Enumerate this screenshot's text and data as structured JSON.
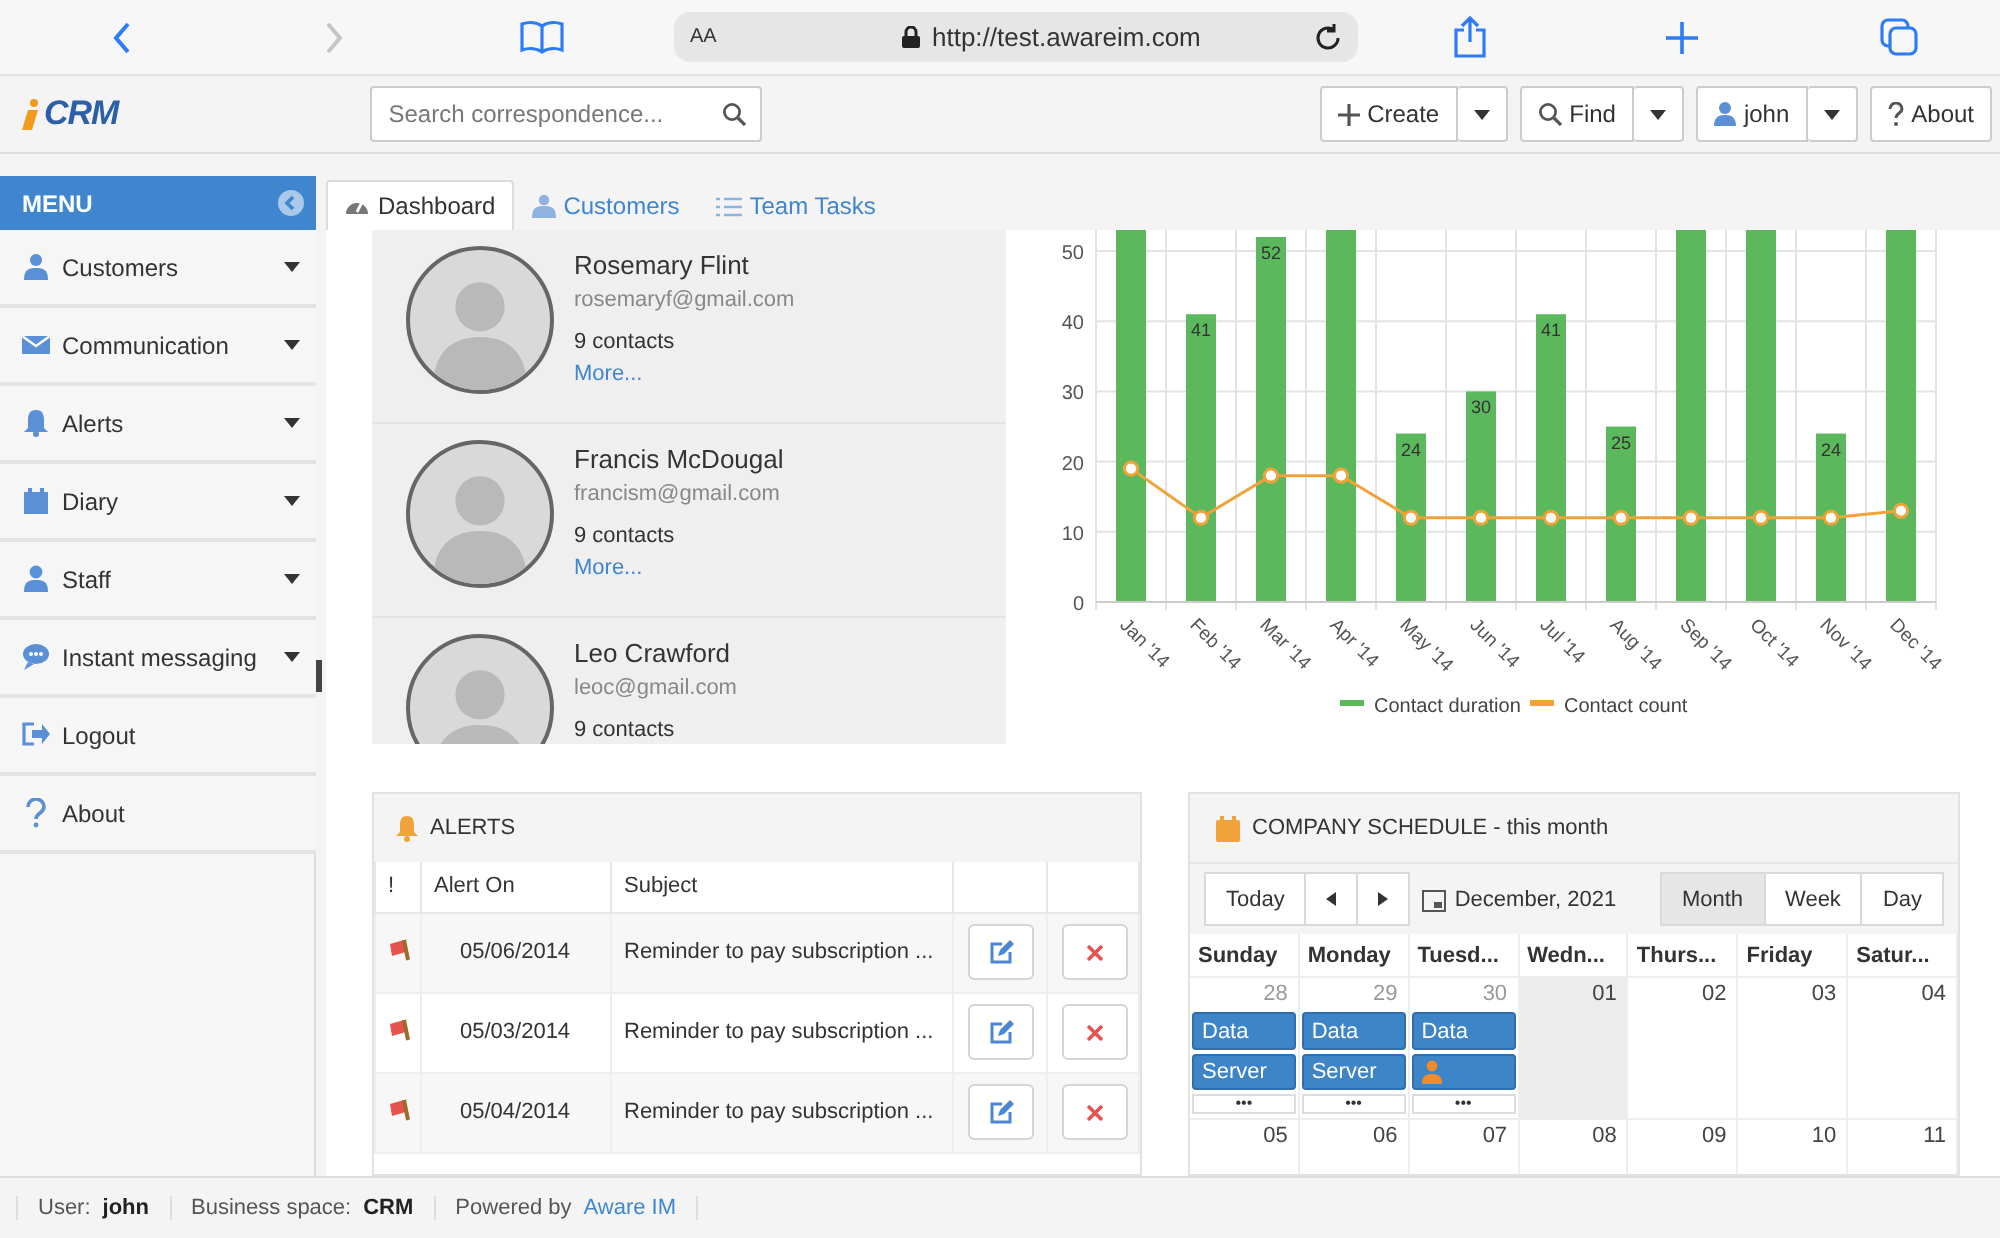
{
  "browser": {
    "text_size": "AA",
    "url": "http://test.awareim.com"
  },
  "header": {
    "logo": "CRM",
    "search": {
      "placeholder": "Search correspondence..."
    },
    "buttons": [
      {
        "label": "Create",
        "kind": "split"
      },
      {
        "label": "Find",
        "kind": "split"
      },
      {
        "label": "john",
        "kind": "split"
      },
      {
        "label": "About",
        "kind": "plain"
      }
    ]
  },
  "menu": {
    "title": "MENU",
    "items": [
      {
        "label": "Customers",
        "expandable": true
      },
      {
        "label": "Communication",
        "expandable": true
      },
      {
        "label": "Alerts",
        "expandable": true
      },
      {
        "label": "Diary",
        "expandable": true
      },
      {
        "label": "Staff",
        "expandable": true
      },
      {
        "label": "Instant messaging",
        "expandable": true
      },
      {
        "label": "Logout",
        "expandable": false
      },
      {
        "label": "About",
        "expandable": false
      }
    ]
  },
  "tabs": [
    {
      "label": "Dashboard",
      "selected": true
    },
    {
      "label": "Customers",
      "selected": false
    },
    {
      "label": "Team Tasks",
      "selected": false
    }
  ],
  "contacts": [
    {
      "name": "Rosemary Flint",
      "email": "rosemaryf@gmail.com",
      "count": "9 contacts",
      "link": "More..."
    },
    {
      "name": "Francis McDougal",
      "email": "francism@gmail.com",
      "count": "9 contacts",
      "link": "More..."
    },
    {
      "name": "Leo Crawford",
      "email": "leoc@gmail.com",
      "count": "9 contacts"
    }
  ],
  "chart": {
    "chart_data": {
      "type": "bar",
      "categories": [
        "Jan '14",
        "Feb '14",
        "Mar '14",
        "Apr '14",
        "May '14",
        "Jun '14",
        "Jul '14",
        "Aug '14",
        "Sep '14",
        "Oct '14",
        "Nov '14",
        "Dec '14"
      ],
      "series": [
        {
          "name": "Contact duration",
          "type": "bar",
          "color": "#5cb85c",
          "values": [
            53,
            41,
            52,
            53,
            24,
            30,
            41,
            25,
            53,
            53,
            24,
            53
          ]
        },
        {
          "name": "Contact count",
          "type": "line",
          "marker": "circle",
          "color": "#f0a33a",
          "values": [
            19,
            12,
            18,
            18,
            12,
            12,
            12,
            12,
            12,
            12,
            12,
            13
          ]
        }
      ],
      "ylim": [
        0,
        53
      ],
      "yticks": [
        0,
        10,
        20,
        30,
        40,
        50
      ],
      "grid": true,
      "legend": "bottom",
      "value_labels": [
        null,
        "41",
        "52",
        null,
        "24",
        "30",
        "41",
        "25",
        null,
        null,
        "24",
        null
      ]
    }
  },
  "alerts": {
    "title": "ALERTS",
    "columns": [
      "!",
      "Alert On",
      "Subject"
    ],
    "rows": [
      {
        "date": "05/06/2014",
        "subject": "Reminder to pay subscription ..."
      },
      {
        "date": "05/03/2014",
        "subject": "Reminder to pay subscription ..."
      },
      {
        "date": "05/04/2014",
        "subject": "Reminder to pay subscription ..."
      }
    ]
  },
  "schedule": {
    "title": "COMPANY SCHEDULE - this month",
    "today_button": "Today",
    "period": "December, 2021",
    "views": [
      {
        "label": "Month",
        "selected": true
      },
      {
        "label": "Week",
        "selected": false
      },
      {
        "label": "Day",
        "selected": false
      }
    ],
    "days": [
      "Sunday",
      "Monday",
      "Tuesd...",
      "Wedn...",
      "Thurs...",
      "Friday",
      "Satur..."
    ],
    "weeks": [
      [
        {
          "date": "28",
          "other_month": true,
          "today": false,
          "events": [
            {
              "kind": "plain",
              "title": "Data"
            },
            {
              "kind": "plain",
              "title": "Server"
            }
          ],
          "more": "•••"
        },
        {
          "date": "29",
          "other_month": true,
          "today": false,
          "events": [
            {
              "kind": "plain",
              "title": "Data"
            },
            {
              "kind": "plain",
              "title": "Server"
            }
          ],
          "more": "•••"
        },
        {
          "date": "30",
          "other_month": true,
          "today": false,
          "events": [
            {
              "kind": "plain",
              "title": "Data"
            },
            {
              "kind": "person"
            }
          ],
          "more": "•••"
        },
        {
          "date": "01",
          "other_month": false,
          "today": true
        },
        {
          "date": "02",
          "other_month": false,
          "today": false
        },
        {
          "date": "03",
          "other_month": false,
          "today": false
        },
        {
          "date": "04",
          "other_month": false,
          "today": false
        }
      ],
      [
        {
          "date": "05",
          "other_month": false,
          "today": false
        },
        {
          "date": "06",
          "other_month": false,
          "today": false
        },
        {
          "date": "07",
          "other_month": false,
          "today": false
        },
        {
          "date": "08",
          "other_month": false,
          "today": false
        },
        {
          "date": "09",
          "other_month": false,
          "today": false
        },
        {
          "date": "10",
          "other_month": false,
          "today": false
        },
        {
          "date": "11",
          "other_month": false,
          "today": false
        }
      ]
    ]
  },
  "status": {
    "user_label": "User:",
    "user": "john",
    "space_label": "Business space:",
    "space": "CRM",
    "powered_label": "Powered by",
    "powered_link": "Aware IM"
  }
}
